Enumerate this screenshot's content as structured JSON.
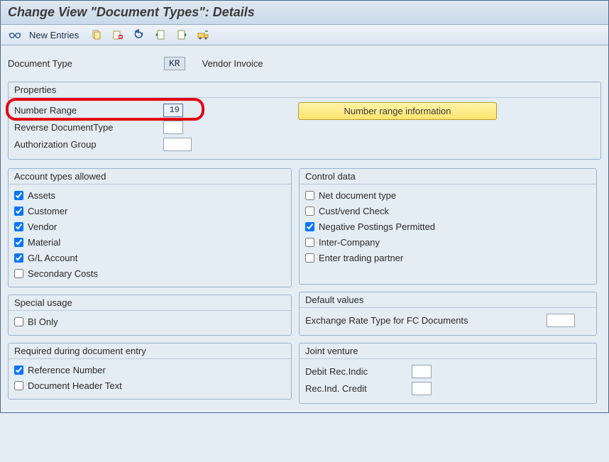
{
  "title": "Change View \"Document Types\": Details",
  "toolbar": {
    "new_entries": "New Entries"
  },
  "header": {
    "label": "Document Type",
    "code": "KR",
    "desc": "Vendor Invoice"
  },
  "properties": {
    "title": "Properties",
    "number_range_label": "Number Range",
    "number_range_value": "19",
    "reverse_doc_label": "Reverse DocumentType",
    "reverse_doc_value": "",
    "auth_group_label": "Authorization Group",
    "auth_group_value": "",
    "nr_info_btn": "Number range information"
  },
  "account_types": {
    "title": "Account types allowed",
    "items": [
      {
        "label": "Assets",
        "checked": true
      },
      {
        "label": "Customer",
        "checked": true
      },
      {
        "label": "Vendor",
        "checked": true
      },
      {
        "label": "Material",
        "checked": true
      },
      {
        "label": "G/L Account",
        "checked": true
      },
      {
        "label": "Secondary Costs",
        "checked": false
      }
    ]
  },
  "control_data": {
    "title": "Control data",
    "items": [
      {
        "label": "Net document type",
        "checked": false
      },
      {
        "label": "Cust/vend Check",
        "checked": false
      },
      {
        "label": "Negative Postings Permitted",
        "checked": true
      },
      {
        "label": "Inter-Company",
        "checked": false
      },
      {
        "label": "Enter trading partner",
        "checked": false
      }
    ]
  },
  "special_usage": {
    "title": "Special usage",
    "items": [
      {
        "label": "BI Only",
        "checked": false
      }
    ]
  },
  "default_values": {
    "title": "Default values",
    "exch_rate_label": "Exchange Rate Type for FC Documents",
    "exch_rate_value": ""
  },
  "required_entry": {
    "title": "Required during document entry",
    "items": [
      {
        "label": "Reference Number",
        "checked": true
      },
      {
        "label": "Document Header Text",
        "checked": false
      }
    ]
  },
  "joint_venture": {
    "title": "Joint venture",
    "debit_label": "Debit Rec.Indic",
    "debit_value": "",
    "credit_label": "Rec.Ind. Credit",
    "credit_value": ""
  }
}
